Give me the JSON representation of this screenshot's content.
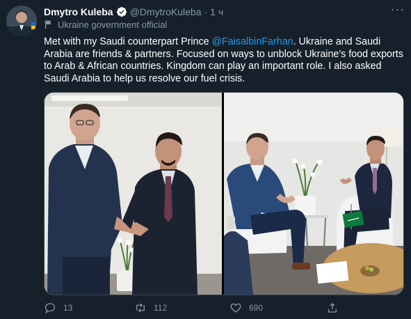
{
  "author": {
    "name": "Dmytro Kuleba",
    "handle": "@DmytroKuleba",
    "time": "1 ч",
    "label": "Ukraine government official"
  },
  "tweet": {
    "text_before": "Met with my Saudi counterpart Prince ",
    "mention": "@FaisalbinFarhan",
    "text_after": ". Ukraine and Saudi Arabia are friends & partners. Focused on ways to unblock Ukraine's food exports to Arab & African countries. Kingdom can play an important role. I also asked Saudi Arabia to help us resolve our fuel crisis."
  },
  "actions": {
    "replies": "13",
    "retweets": "112",
    "likes": "690"
  },
  "colors": {
    "background": "#15202b",
    "accent": "#1d9bf0",
    "muted": "#8899a6"
  },
  "icons": [
    "verified-badge-icon",
    "government-flag-icon",
    "more-icon",
    "reply-icon",
    "retweet-icon",
    "like-icon",
    "share-icon"
  ]
}
